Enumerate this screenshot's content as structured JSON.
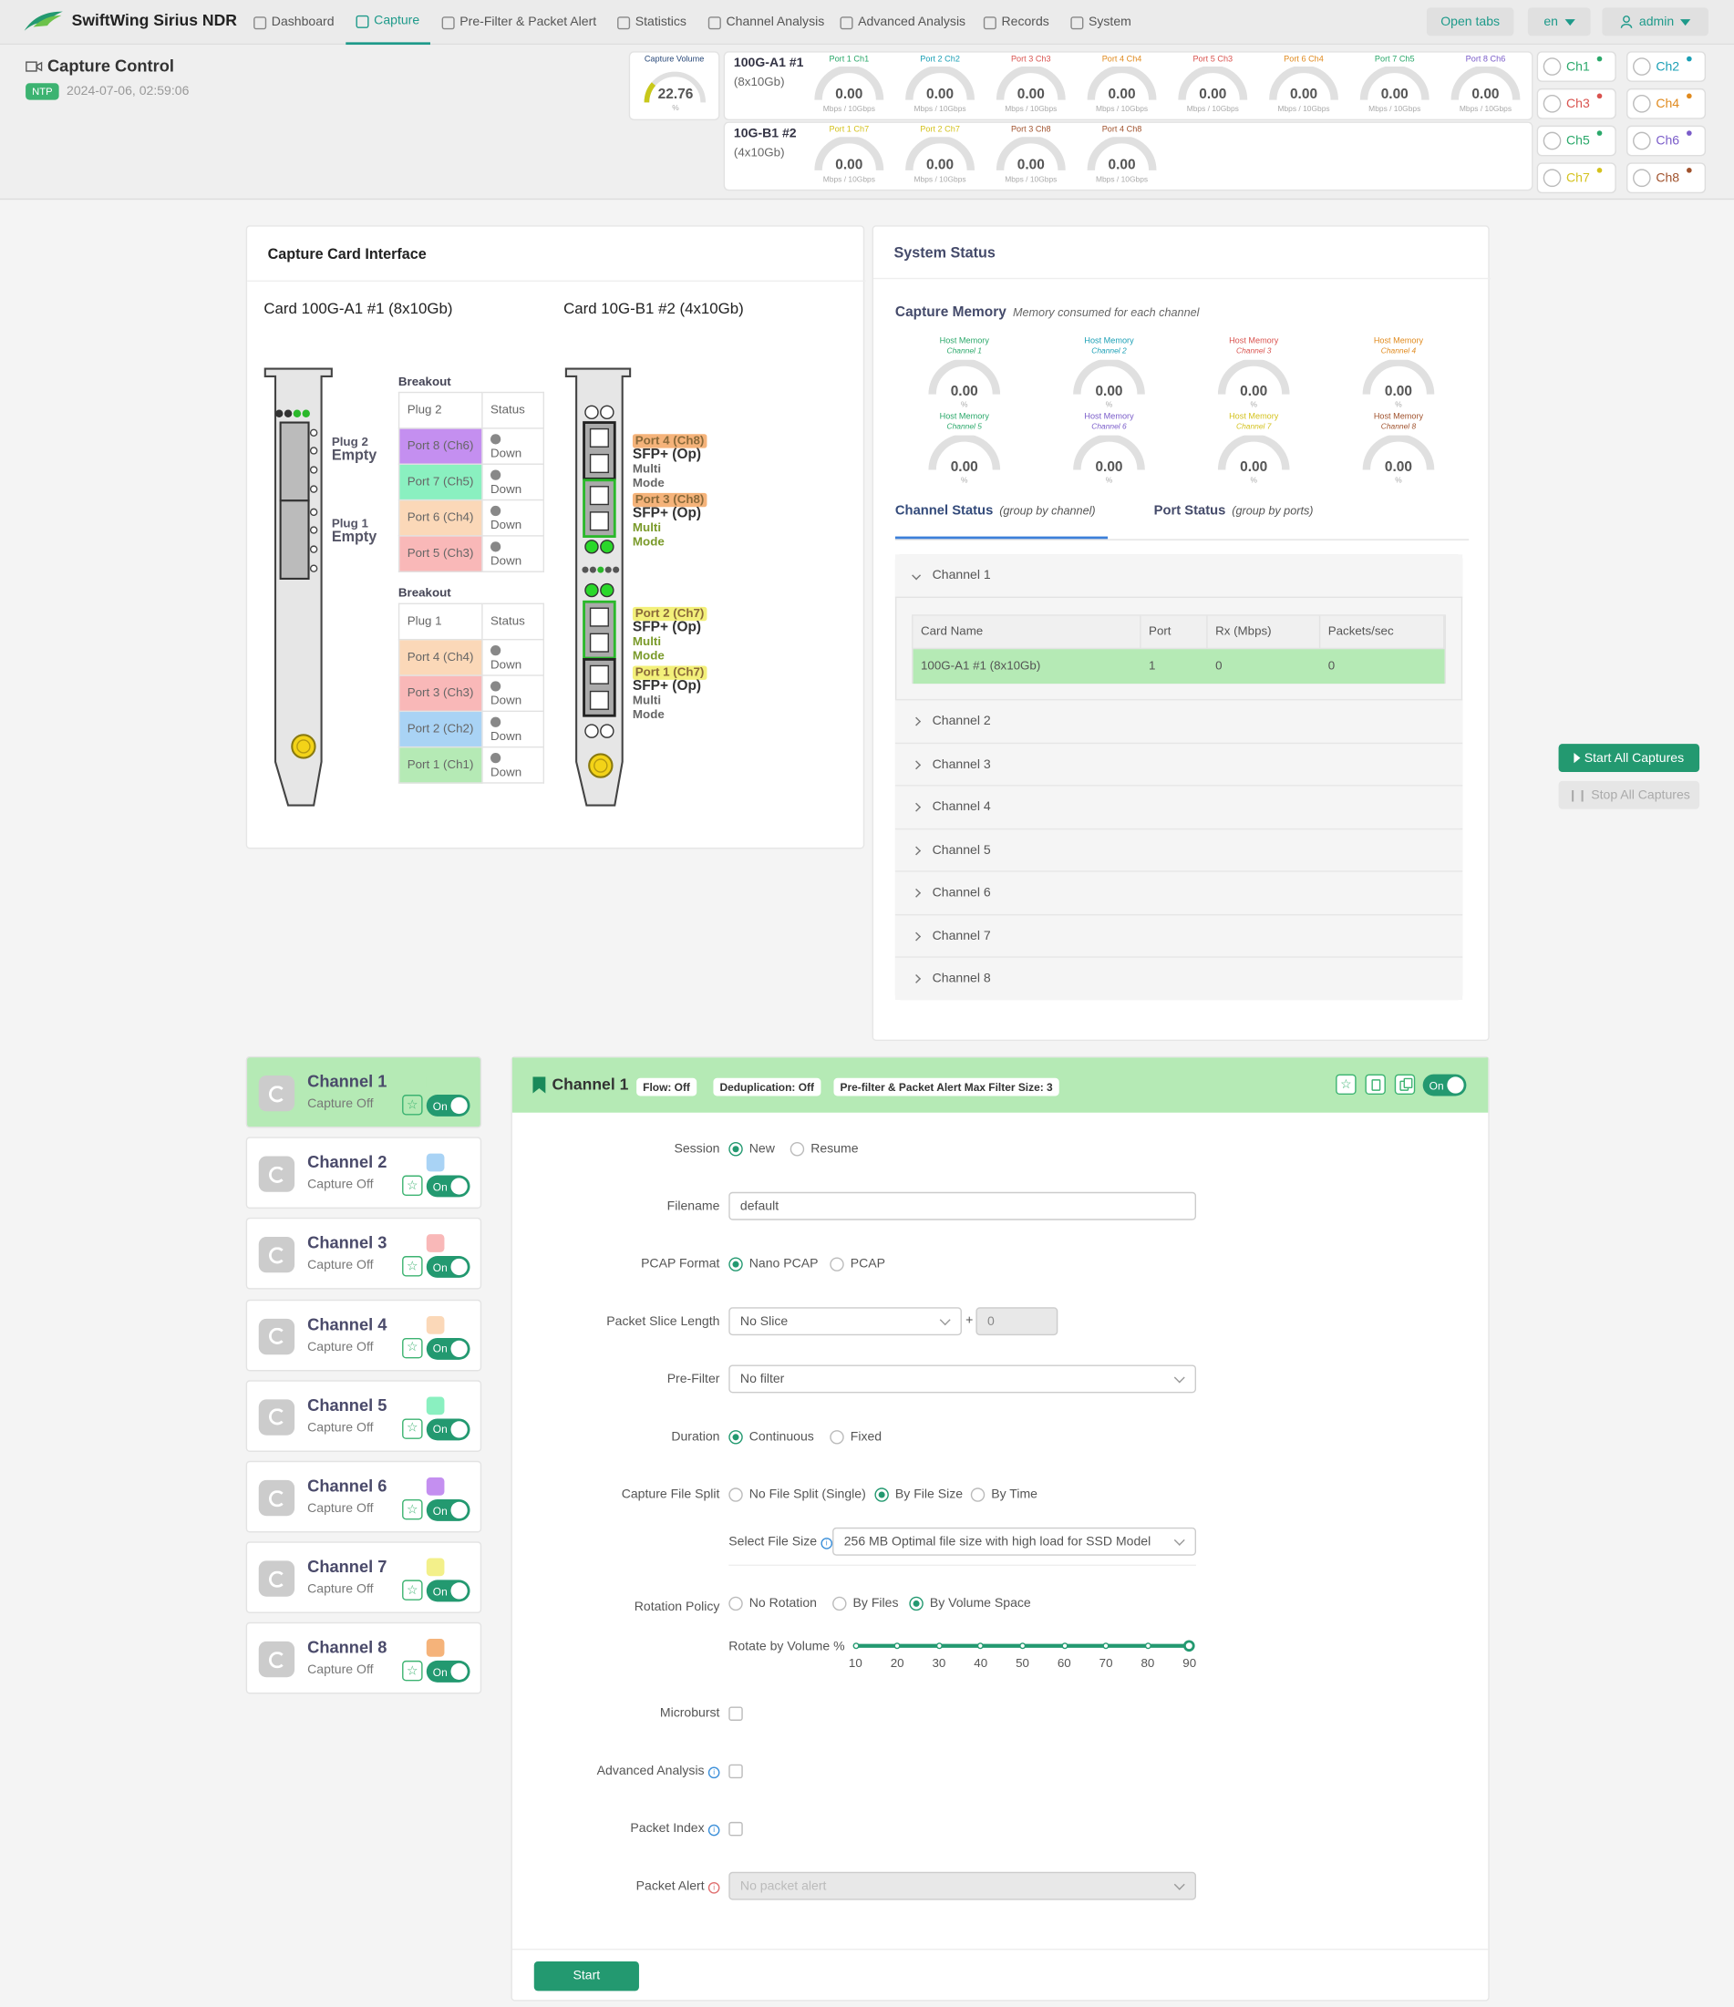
{
  "app": {
    "name": "SwiftWing Sirius NDR"
  },
  "nav": [
    {
      "label": "Dashboard",
      "icon": "home-icon"
    },
    {
      "label": "Capture",
      "icon": "camera-icon"
    },
    {
      "label": "Pre-Filter & Packet Alert",
      "icon": "clipboard-icon"
    },
    {
      "label": "Statistics",
      "icon": "pulse-icon"
    },
    {
      "label": "Channel Analysis",
      "icon": "wand-icon"
    },
    {
      "label": "Advanced Analysis",
      "icon": "wand-icon"
    },
    {
      "label": "Records",
      "icon": "folder-icon"
    },
    {
      "label": "System",
      "icon": "clipboard-icon"
    }
  ],
  "topright": {
    "open_tabs": "Open tabs",
    "lang": "en",
    "user": "admin"
  },
  "page": {
    "title": "Capture Control",
    "ntp": "NTP",
    "datetime": "2024-07-06, 02:59:06"
  },
  "capture_volume": {
    "label": "Capture Volume",
    "value": "22.76",
    "unit": "%",
    "fraction": 0.2276
  },
  "card1_head": {
    "name": "100G-A1 #1",
    "sub": "(8x10Gb)",
    "ports": [
      {
        "port": "Port 1",
        "ch": "Ch1",
        "color": "#2aa86a",
        "value": "0.00",
        "unit": "Mbps / 10Gbps"
      },
      {
        "port": "Port 2",
        "ch": "Ch2",
        "color": "#1a9fb5",
        "value": "0.00",
        "unit": "Mbps / 10Gbps"
      },
      {
        "port": "Port 3",
        "ch": "Ch3",
        "color": "#d9534f",
        "value": "0.00",
        "unit": "Mbps / 10Gbps"
      },
      {
        "port": "Port 4",
        "ch": "Ch4",
        "color": "#e08a1e",
        "value": "0.00",
        "unit": "Mbps / 10Gbps"
      },
      {
        "port": "Port 5",
        "ch": "Ch3",
        "color": "#d9534f",
        "value": "0.00",
        "unit": "Mbps / 10Gbps"
      },
      {
        "port": "Port 6",
        "ch": "Ch4",
        "color": "#e08a1e",
        "value": "0.00",
        "unit": "Mbps / 10Gbps"
      },
      {
        "port": "Port 7",
        "ch": "Ch5",
        "color": "#2aa86a",
        "value": "0.00",
        "unit": "Mbps / 10Gbps"
      },
      {
        "port": "Port 8",
        "ch": "Ch6",
        "color": "#7a5cc9",
        "value": "0.00",
        "unit": "Mbps / 10Gbps"
      }
    ]
  },
  "card2_head": {
    "name": "10G-B1 #2",
    "sub": "(4x10Gb)",
    "ports": [
      {
        "port": "Port 1",
        "ch": "Ch7",
        "color": "#d4c21e",
        "value": "0.00",
        "unit": "Mbps / 10Gbps"
      },
      {
        "port": "Port 2",
        "ch": "Ch7",
        "color": "#d4c21e",
        "value": "0.00",
        "unit": "Mbps / 10Gbps"
      },
      {
        "port": "Port 3",
        "ch": "Ch8",
        "color": "#a0522d",
        "value": "0.00",
        "unit": "Mbps / 10Gbps"
      },
      {
        "port": "Port 4",
        "ch": "Ch8",
        "color": "#a0522d",
        "value": "0.00",
        "unit": "Mbps / 10Gbps"
      }
    ]
  },
  "ch_quick": [
    {
      "label": "Ch1",
      "color": "#2aa86a"
    },
    {
      "label": "Ch2",
      "color": "#1a9fb5"
    },
    {
      "label": "Ch3",
      "color": "#d9534f"
    },
    {
      "label": "Ch4",
      "color": "#e08a1e"
    },
    {
      "label": "Ch5",
      "color": "#2aa86a"
    },
    {
      "label": "Ch6",
      "color": "#7a5cc9"
    },
    {
      "label": "Ch7",
      "color": "#d4c21e"
    },
    {
      "label": "Ch8",
      "color": "#a0522d"
    }
  ],
  "cci": {
    "title": "Capture Card Interface",
    "card1": "Card 100G-A1 #1 (8x10Gb)",
    "card2": "Card 10G-B1 #2 (4x10Gb)",
    "plug2": {
      "name": "Plug 2",
      "state": "Empty"
    },
    "plug1": {
      "name": "Plug 1",
      "state": "Empty"
    },
    "breakout_label": "Breakout",
    "status_label": "Status",
    "bk2": {
      "plug": "Plug 2",
      "rows": [
        {
          "port": "Port 8 (Ch6)",
          "status": "Down",
          "color": "#c48ff0"
        },
        {
          "port": "Port 7 (Ch5)",
          "status": "Down",
          "color": "#8af0c0"
        },
        {
          "port": "Port 6 (Ch4)",
          "status": "Down",
          "color": "#fbd8b8"
        },
        {
          "port": "Port 5 (Ch3)",
          "status": "Down",
          "color": "#f9b8b8"
        }
      ]
    },
    "bk1": {
      "plug": "Plug 1",
      "rows": [
        {
          "port": "Port 4 (Ch4)",
          "status": "Down",
          "color": "#fbd8b8"
        },
        {
          "port": "Port 3 (Ch3)",
          "status": "Down",
          "color": "#f9b8b8"
        },
        {
          "port": "Port 2 (Ch2)",
          "status": "Down",
          "color": "#a9d3f5"
        },
        {
          "port": "Port 1 (Ch1)",
          "status": "Down",
          "color": "#b5eab5"
        }
      ]
    },
    "sfp": [
      {
        "tag": "Port 4 (Ch8)",
        "tagcolor": "#f5b37a",
        "type": "SFP+ (Op)",
        "mode1": "Multi",
        "mode2": "Mode",
        "modecolor": "#666"
      },
      {
        "tag": "Port 3 (Ch8)",
        "tagcolor": "#f5b37a",
        "type": "SFP+ (Op)",
        "mode1": "Multi",
        "mode2": "Mode",
        "modecolor": "#7a9a2a"
      },
      {
        "tag": "Port 2 (Ch7)",
        "tagcolor": "#f3f07a",
        "type": "SFP+ (Op)",
        "mode1": "Multi",
        "mode2": "Mode",
        "modecolor": "#7a9a2a"
      },
      {
        "tag": "Port 1 (Ch7)",
        "tagcolor": "#f3f07a",
        "type": "SFP+ (Op)",
        "mode1": "Multi",
        "mode2": "Mode",
        "modecolor": "#666"
      }
    ]
  },
  "system": {
    "title": "System Status",
    "mem_title": "Capture Memory",
    "mem_sub": "Memory consumed for each channel",
    "mem": [
      {
        "label": "Host Memory",
        "ch": "Channel 1",
        "color": "#2aa86a",
        "value": "0.00",
        "unit": "%"
      },
      {
        "label": "Host Memory",
        "ch": "Channel 2",
        "color": "#1a9fb5",
        "value": "0.00",
        "unit": "%"
      },
      {
        "label": "Host Memory",
        "ch": "Channel 3",
        "color": "#d9534f",
        "value": "0.00",
        "unit": "%"
      },
      {
        "label": "Host Memory",
        "ch": "Channel 4",
        "color": "#e08a1e",
        "value": "0.00",
        "unit": "%"
      },
      {
        "label": "Host Memory",
        "ch": "Channel 5",
        "color": "#2aa86a",
        "value": "0.00",
        "unit": "%"
      },
      {
        "label": "Host Memory",
        "ch": "Channel 6",
        "color": "#7a5cc9",
        "value": "0.00",
        "unit": "%"
      },
      {
        "label": "Host Memory",
        "ch": "Channel 7",
        "color": "#d4c21e",
        "value": "0.00",
        "unit": "%"
      },
      {
        "label": "Host Memory",
        "ch": "Channel 8",
        "color": "#a0522d",
        "value": "0.00",
        "unit": "%"
      }
    ],
    "tab1": "Channel Status",
    "tab1_sub": "(group by channel)",
    "tab2": "Port Status",
    "tab2_sub": "(group by ports)",
    "acc": [
      "Channel 1",
      "Channel 2",
      "Channel 3",
      "Channel 4",
      "Channel 5",
      "Channel 6",
      "Channel 7",
      "Channel 8"
    ],
    "cols": [
      "Card Name",
      "Port",
      "Rx (Mbps)",
      "Packets/sec"
    ],
    "row": [
      "100G-A1 #1 (8x10Gb)",
      "1",
      "0",
      "0"
    ]
  },
  "actions": {
    "start_all": "Start All Captures",
    "stop_all": "Stop All Captures"
  },
  "channels": [
    {
      "name": "Channel 1",
      "status": "Capture Off",
      "color": "#b5eab5",
      "toggle": "On"
    },
    {
      "name": "Channel 2",
      "status": "Capture Off",
      "color": "#a9d3f5",
      "toggle": "On"
    },
    {
      "name": "Channel 3",
      "status": "Capture Off",
      "color": "#f9b8b8",
      "toggle": "On"
    },
    {
      "name": "Channel 4",
      "status": "Capture Off",
      "color": "#fbd8b8",
      "toggle": "On"
    },
    {
      "name": "Channel 5",
      "status": "Capture Off",
      "color": "#8af0c0",
      "toggle": "On"
    },
    {
      "name": "Channel 6",
      "status": "Capture Off",
      "color": "#c48ff0",
      "toggle": "On"
    },
    {
      "name": "Channel 7",
      "status": "Capture Off",
      "color": "#f3f08a",
      "toggle": "On"
    },
    {
      "name": "Channel 8",
      "status": "Capture Off",
      "color": "#f5b37a",
      "toggle": "On"
    }
  ],
  "form": {
    "title": "Channel 1",
    "tags": [
      "Flow: Off",
      "Deduplication: Off",
      "Pre-filter & Packet Alert Max Filter Size: 3"
    ],
    "toggle": "On",
    "session": {
      "label": "Session",
      "opts": [
        "New",
        "Resume"
      ]
    },
    "filename": {
      "label": "Filename",
      "value": "default"
    },
    "pcap": {
      "label": "PCAP Format",
      "opts": [
        "Nano PCAP",
        "PCAP"
      ]
    },
    "slice": {
      "label": "Packet Slice Length",
      "value": "No Slice",
      "plus": "+",
      "num": "0"
    },
    "prefilter": {
      "label": "Pre-Filter",
      "value": "No filter"
    },
    "duration": {
      "label": "Duration",
      "opts": [
        "Continuous",
        "Fixed"
      ]
    },
    "split": {
      "label": "Capture File Split",
      "opts": [
        "No File Split (Single)",
        "By File Size",
        "By Time"
      ]
    },
    "filesize": {
      "label": "Select File Size",
      "value": "256 MB Optimal file size with high load for SSD Model"
    },
    "rotation": {
      "label": "Rotation Policy",
      "opts": [
        "No Rotation",
        "By Files",
        "By Volume Space"
      ]
    },
    "rotate_vol": {
      "label": "Rotate by Volume %",
      "ticks": [
        "10",
        "20",
        "30",
        "40",
        "50",
        "60",
        "70",
        "80",
        "90"
      ],
      "value": 90
    },
    "microburst": {
      "label": "Microburst"
    },
    "advanced": {
      "label": "Advanced Analysis"
    },
    "pindex": {
      "label": "Packet Index"
    },
    "palert": {
      "label": "Packet Alert",
      "value": "No packet alert"
    },
    "start": "Start"
  }
}
